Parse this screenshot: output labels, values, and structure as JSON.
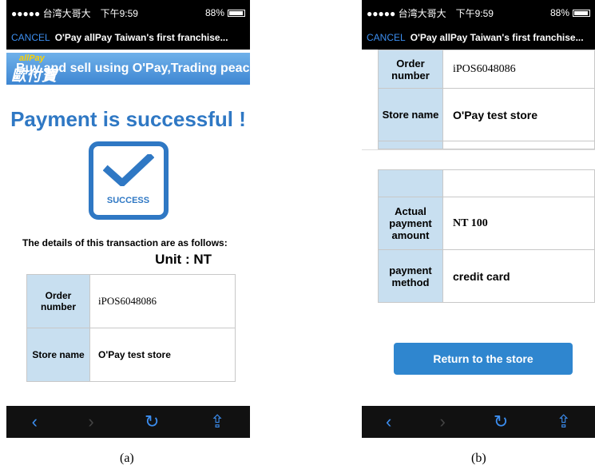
{
  "status_bar": {
    "carrier": "●●●●● 台湾大哥大",
    "time": "下午9:59",
    "battery": "88%"
  },
  "navbar": {
    "cancel": "CANCEL",
    "title": "O'Pay allPay Taiwan's first franchise..."
  },
  "banner": {
    "logo_top": "allPay",
    "logo_main": "歐付寶",
    "text": "Buy and sell using O'Pay,Trading peace of mind"
  },
  "screen_a": {
    "title": "Payment is successful !",
    "success_label": "SUCCESS",
    "details_text": "The details of this transaction are as follows:",
    "unit": "Unit : NT",
    "rows": [
      {
        "label": "Order number",
        "value": "iPOS6048086"
      },
      {
        "label": "Store name",
        "value": "O'Pay test store"
      }
    ]
  },
  "screen_b": {
    "rows_top": [
      {
        "label": "Order number",
        "value": "iPOS6048086"
      },
      {
        "label": "Store name",
        "value": "O'Pay test store"
      }
    ],
    "rows_bottom": [
      {
        "label": "Actual payment amount",
        "value": "NT 100"
      },
      {
        "label": "payment method",
        "value": "credit card"
      }
    ],
    "return_button": "Return to the store"
  },
  "toolbar": {
    "back": "‹",
    "forward": "›",
    "reload": "↻",
    "share": "⇪"
  },
  "captions": {
    "a": "(a)",
    "b": "(b)"
  }
}
